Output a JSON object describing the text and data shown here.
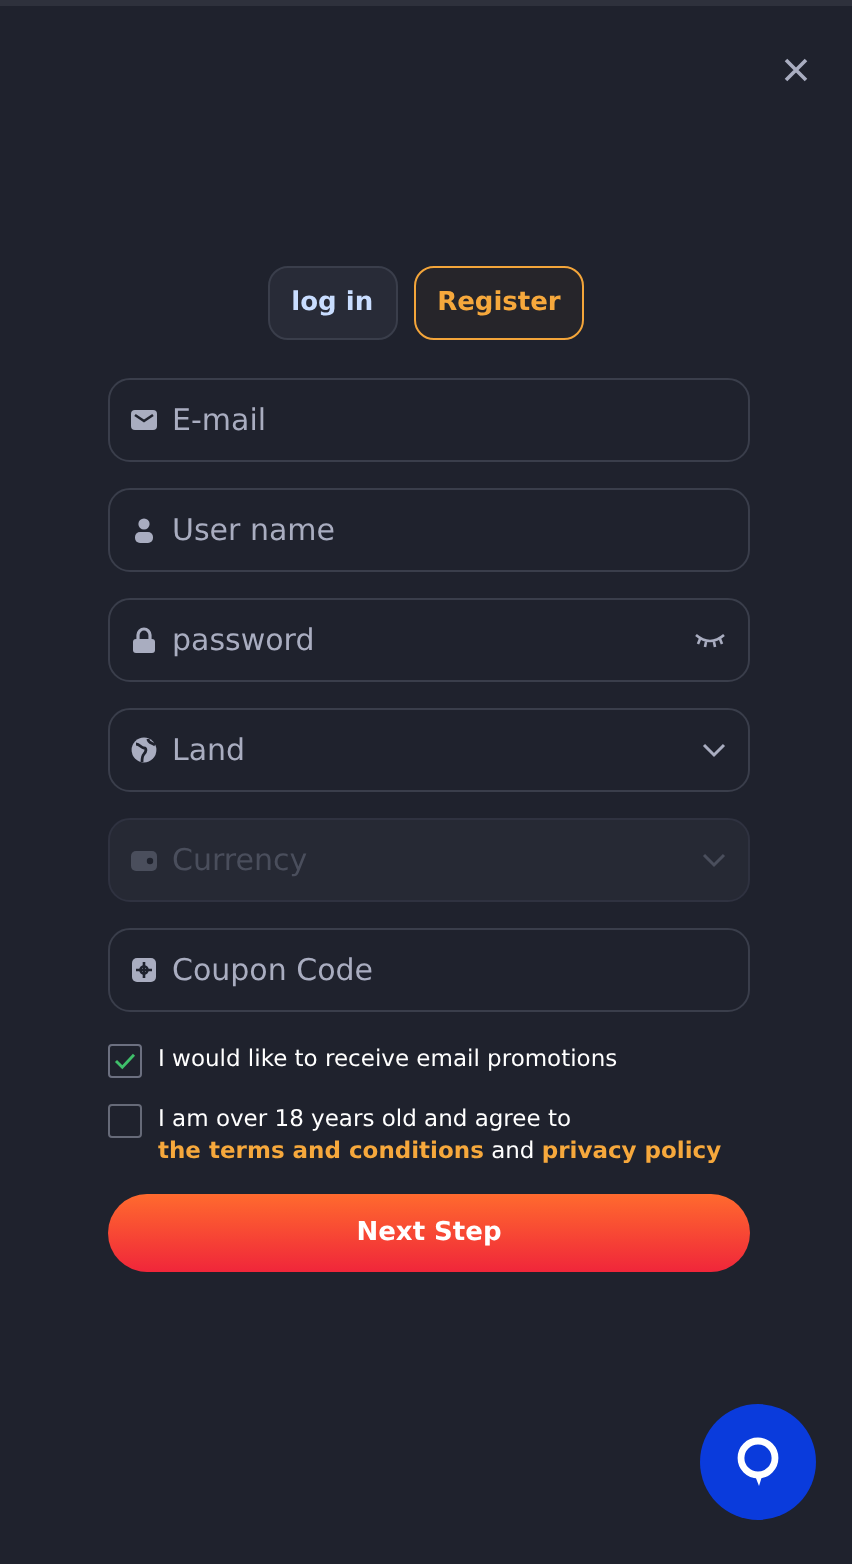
{
  "tabs": [
    {
      "label": "log in",
      "selected": false
    },
    {
      "label": "Register",
      "selected": true
    }
  ],
  "fields": [
    {
      "kind": "text",
      "placeholder": "E-mail",
      "disabled": false
    },
    {
      "kind": "text",
      "placeholder": "User name",
      "disabled": false
    },
    {
      "kind": "password",
      "placeholder": "password",
      "disabled": false
    },
    {
      "kind": "select",
      "placeholder": "Land",
      "disabled": false
    },
    {
      "kind": "select",
      "placeholder": "Currency",
      "disabled": true
    },
    {
      "kind": "text",
      "placeholder": "Coupon Code",
      "disabled": false
    }
  ],
  "consents": [
    {
      "checked": true,
      "parts": [
        {
          "kind": "text",
          "text": "I would like to receive email promotions"
        }
      ]
    },
    {
      "checked": false,
      "parts": [
        {
          "kind": "text",
          "text": "I am over 18 years old and agree to "
        },
        {
          "kind": "link",
          "text": "the terms and conditions"
        },
        {
          "kind": "text",
          "text": " and "
        },
        {
          "kind": "link",
          "text": "privacy policy"
        }
      ]
    }
  ],
  "submit": "Next Step"
}
